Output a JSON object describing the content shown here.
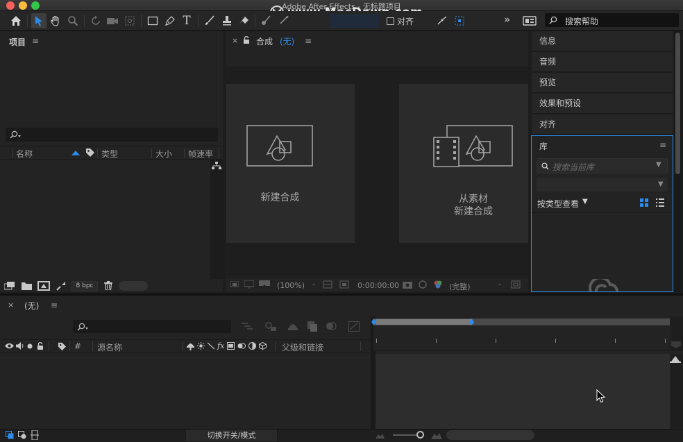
{
  "window": {
    "title": "Adobe After Effects - 无标题项目",
    "watermark": "www.MacDown.com"
  },
  "colors": {
    "accent": "#2d8ceb",
    "panel": "#232323",
    "text": "#b8b8b8"
  },
  "toolbar": {
    "tools": [
      "home-icon",
      "selection-tool-icon",
      "hand-tool-icon",
      "zoom-tool-icon",
      "rotate-tool-icon",
      "camera-tool-icon",
      "pan-behind-tool-icon",
      "rectangle-tool-icon",
      "pen-tool-icon",
      "type-tool-icon",
      "brush-tool-icon",
      "clone-stamp-tool-icon",
      "eraser-tool-icon",
      "roto-brush-tool-icon",
      "puppet-tool-icon"
    ],
    "align_label": "对齐",
    "more_label": "»",
    "search_placeholder": "搜索帮助"
  },
  "project_panel": {
    "title": "项目",
    "columns": [
      "名称",
      "类型",
      "大小",
      "帧速率"
    ],
    "bpc": "8 bpc"
  },
  "comp_panel": {
    "tab_label": "合成",
    "tab_value": "(无)",
    "new_comp": "新建合成",
    "from_footage_line1": "从素材",
    "from_footage_line2": "新建合成",
    "zoom": "(100%)",
    "timecode": "0:00:00:00",
    "resolution": "(完整)"
  },
  "right_panels": {
    "tabs": [
      "信息",
      "音频",
      "预览",
      "效果和预设",
      "对齐"
    ],
    "library_title": "库",
    "library_search_placeholder": "搜索当前库",
    "view_by_type": "按类型查看"
  },
  "timeline": {
    "tab_label": "(无)",
    "columns": [
      "#",
      "源名称",
      "父级和链接"
    ],
    "toggle_label": "切换开关/模式"
  }
}
